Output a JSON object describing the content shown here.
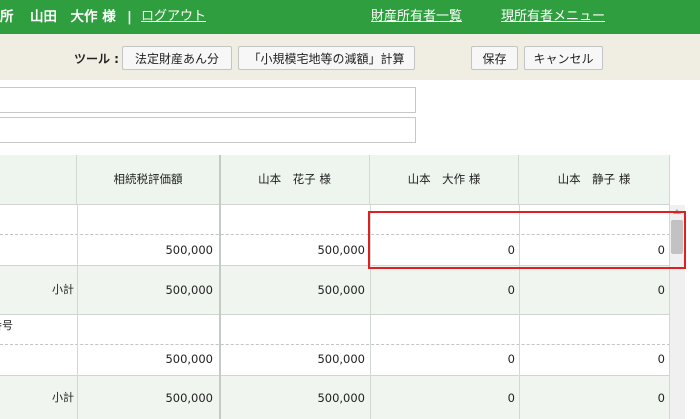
{
  "header": {
    "office_fragment": "所",
    "user_name": "山田　大作 様",
    "separator": "|",
    "logout_label": "ログアウト",
    "asset_owners_link": "財産所有者一覧",
    "current_owner_menu_link": "現所有者メニュー"
  },
  "toolbar": {
    "tools_label": "ツール :",
    "legal_share_label": "法定財産あん分",
    "small_land_reduction_label": "「小規模宅地等の減額」計算",
    "save_label": "保存",
    "cancel_label": "キャンセル"
  },
  "table": {
    "columns": [
      "相続税評価額",
      "山本　花子 様",
      "山本　大作 様",
      "山本　静子 様"
    ],
    "rows": [
      {
        "label": "",
        "values": [
          "",
          "",
          "",
          ""
        ]
      },
      {
        "label": "",
        "values": [
          "500,000",
          "500,000",
          "0",
          "0"
        ]
      },
      {
        "label": "小計",
        "values": [
          "500,000",
          "500,000",
          "0",
          "0"
        ]
      },
      {
        "label": "番号",
        "values": [
          "",
          "",
          "",
          ""
        ]
      },
      {
        "label": "",
        "values": [
          "500,000",
          "500,000",
          "0",
          "0"
        ]
      },
      {
        "label": "小計",
        "values": [
          "500,000",
          "500,000",
          "0",
          "0"
        ]
      }
    ]
  },
  "colors": {
    "header_green": "#2e9e3e",
    "highlight_red": "#e02020",
    "toolbar_bg": "#f0ede2"
  }
}
